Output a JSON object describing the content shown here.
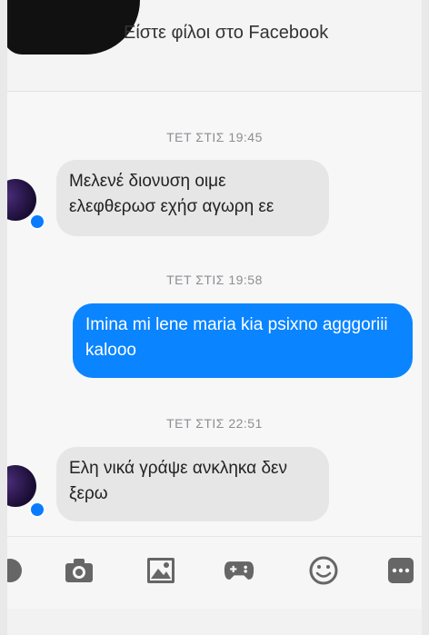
{
  "header": {
    "title": "Είστε φίλοι στο Facebook"
  },
  "messages": [
    {
      "timestamp": "ΤΕΤ ΣΤΙΣ 19:45",
      "direction": "incoming",
      "text": "Μελενέ διονυση οιμε ελεφθερωσ εχήσ αγωρη εε"
    },
    {
      "timestamp": "ΤΕΤ ΣΤΙΣ 19:58",
      "direction": "outgoing",
      "text": "Imina mi lene maria kia psixno agggoriii kalooo"
    },
    {
      "timestamp": "ΤΕΤ ΣΤΙΣ 22:51",
      "direction": "incoming",
      "text": "Ελη νικά γράψε ανκληκα δεν ξερω"
    }
  ],
  "toolbar": {
    "icons": [
      "camera-icon",
      "image-icon",
      "gamepad-icon",
      "emoji-icon",
      "more-icon"
    ]
  },
  "colors": {
    "outgoing_bubble": "#0a84ff",
    "incoming_bubble": "#e6e6e7",
    "badge": "#0a7cff"
  }
}
